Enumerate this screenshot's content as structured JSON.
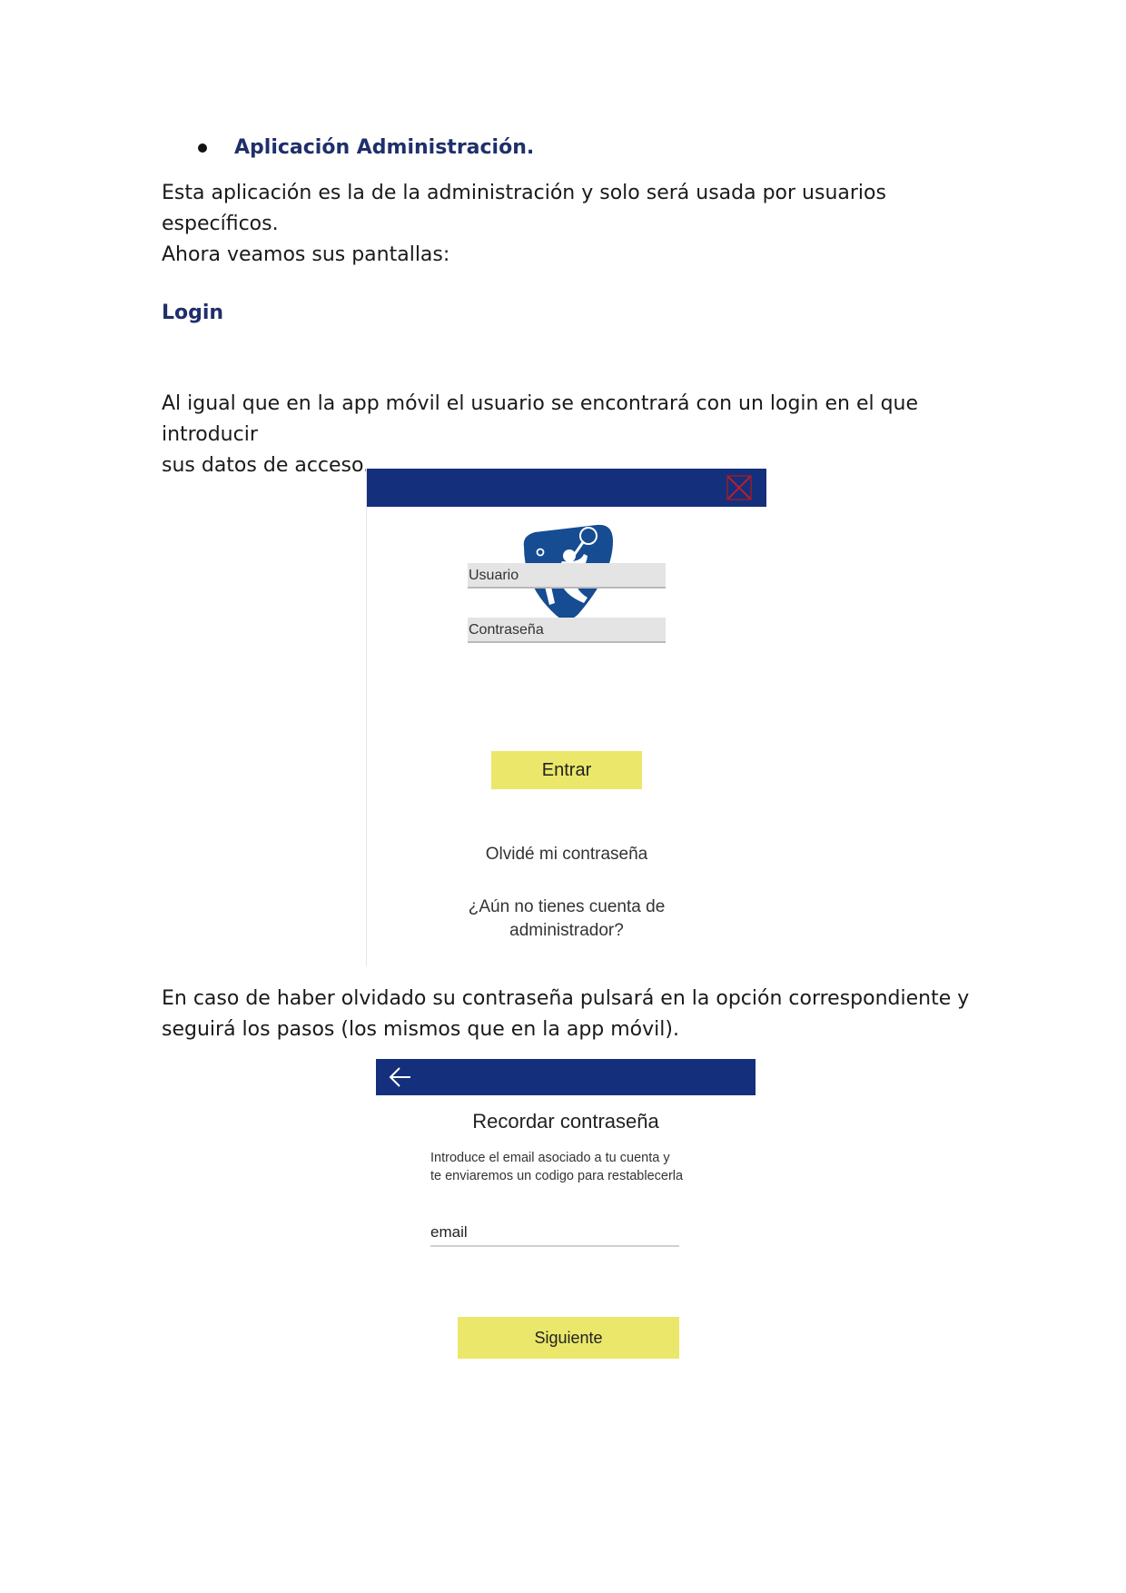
{
  "document": {
    "bullet_heading": "Aplicación Administración.",
    "intro_line1": "Esta aplicación es la de la administración y solo será usada por usuarios específicos.",
    "intro_line2": "Ahora veamos sus pantallas:",
    "login_heading": "Login",
    "login_para_line1": "Al igual que en la app móvil el usuario se encontrará con un login en el que introducir",
    "login_para_line2": "sus datos de acceso.",
    "forgot_para_line1": "En caso de haber olvidado su contraseña pulsará en la opción correspondiente y",
    "forgot_para_line2": "seguirá los pasos (los mismos que en la app móvil)."
  },
  "login_screen": {
    "topbar_color": "#142f7c",
    "close_icon": "close-icon",
    "logo_icon": "tennis-player-logo-icon",
    "username_placeholder": "Usuario",
    "password_placeholder": "Contraseña",
    "enter_button": "Entrar",
    "forgot_link": "Olvidé mi contraseña",
    "register_line1": "¿Aún no tienes cuenta de",
    "register_line2": "administrador?",
    "button_color": "#ebe76a"
  },
  "recover_screen": {
    "topbar_color": "#142f7c",
    "back_icon": "back-arrow-icon",
    "title": "Recordar contraseña",
    "desc_line1": "Introduce el email asociado a tu cuenta y",
    "desc_line2": "te enviaremos un codigo para restablecerla",
    "email_placeholder": "email",
    "next_button": "Siguiente",
    "button_color": "#ebe76a"
  }
}
